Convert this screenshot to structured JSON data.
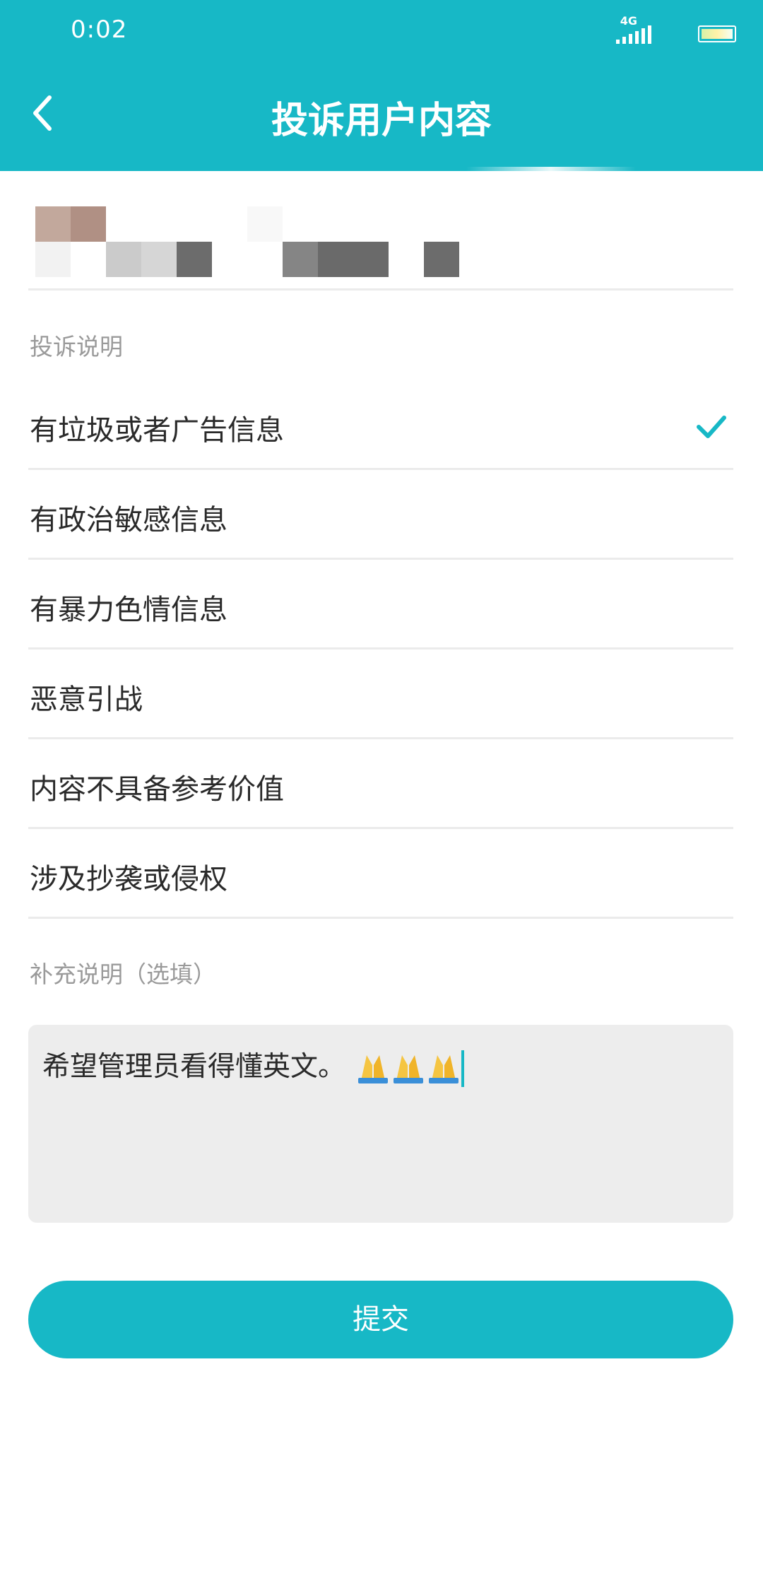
{
  "status_bar": {
    "time": "0:02",
    "network": "4G"
  },
  "header": {
    "title": "投诉用户内容",
    "back_icon": "chevron-left-icon"
  },
  "complaint_section": {
    "label": "投诉说明",
    "options": [
      {
        "label": "有垃圾或者广告信息",
        "selected": true
      },
      {
        "label": "有政治敏感信息",
        "selected": false
      },
      {
        "label": "有暴力色情信息",
        "selected": false
      },
      {
        "label": "恶意引战",
        "selected": false
      },
      {
        "label": "内容不具备参考价值",
        "selected": false
      },
      {
        "label": "涉及抄袭或侵权",
        "selected": false
      }
    ]
  },
  "supplement_section": {
    "label": "补充说明（选填）",
    "value": "希望管理员看得懂英文。"
  },
  "submit_label": "提交",
  "colors": {
    "accent": "#17b8c6",
    "divider": "#ebebeb",
    "input_bg": "#ededed"
  }
}
